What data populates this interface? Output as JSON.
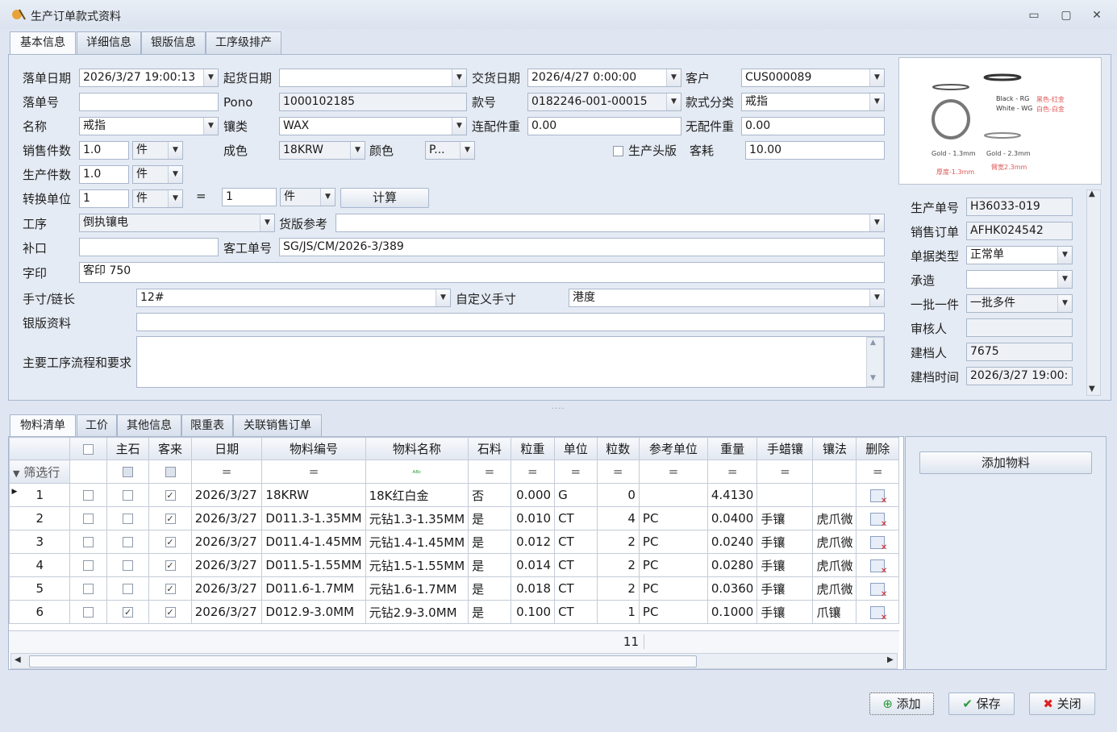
{
  "window": {
    "title": "生产订单款式资料",
    "min": "▭",
    "max": "▢",
    "close": "✕"
  },
  "top_tabs": [
    "基本信息",
    "详细信息",
    "银版信息",
    "工序级排产"
  ],
  "form": {
    "order_date_label": "落单日期",
    "order_date": "2026/3/27 19:00:13",
    "start_date_label": "起货日期",
    "start_date": "",
    "delivery_date_label": "交货日期",
    "delivery_date": "2026/4/27 0:00:00",
    "customer_label": "客户",
    "customer": "CUS000089",
    "order_no_label": "落单号",
    "order_no": "",
    "pono_label": "Pono",
    "pono": "1000102185",
    "style_no_label": "款号",
    "style_no": "0182246-001-00015",
    "style_cat_label": "款式分类",
    "style_cat": "戒指",
    "name_label": "名称",
    "name": "戒指",
    "setting_label": "镶类",
    "setting": "WAX",
    "parts_wt_label": "连配件重",
    "parts_wt": "0.00",
    "no_parts_wt_label": "无配件重",
    "no_parts_wt": "0.00",
    "sales_qty_label": "销售件数",
    "sales_qty": "1.0",
    "sales_unit": "件",
    "color_label": "成色",
    "color": "18KRW",
    "hue_label": "颜色",
    "hue": "P...",
    "prod_head_label": "生产头版",
    "loss_label": "客耗",
    "loss": "10.00",
    "prod_qty_label": "生产件数",
    "prod_qty": "1.0",
    "prod_unit": "件",
    "conv_label": "转换单位",
    "conv_qty": "1",
    "conv_unit": "件",
    "eq": "=",
    "conv_qty2": "1",
    "conv_unit2": "件",
    "calc_button": "计算",
    "process_label": "工序",
    "process": "倒执镶电",
    "goods_ref_label": "货版参考",
    "goods_ref": "",
    "supplement_label": "补口",
    "supplement": "",
    "cust_order_label": "客工单号",
    "cust_order": "SG/JS/CM/2026-3/389",
    "engrave_label": "字印",
    "engrave": "客印 750",
    "size_label": "手寸/链长",
    "size": "12#",
    "custom_size_label": "自定义手寸",
    "custom_size": "港度",
    "silver_label": "银版资料",
    "silver": "",
    "flow_label": "主要工序流程和要求",
    "flow": ""
  },
  "image": {
    "black_rg": "Black - RG",
    "white_wg": "White - WG",
    "red_gold": "黑色-红金",
    "white_gold": "白色-白金",
    "gold_13": "Gold - 1.3mm",
    "gold_23": "Gold - 2.3mm",
    "thick": "厚度-1.3mm",
    "arm": "臂宽2.3mm"
  },
  "side": {
    "prod_no_label": "生产单号",
    "prod_no": "H36033-019",
    "sales_order_label": "销售订单",
    "sales_order": "AFHK024542",
    "doc_type_label": "单据类型",
    "doc_type": "正常单",
    "maker_label": "承造",
    "maker": "",
    "batch_label": "一批一件",
    "batch": "一批多件",
    "reviewer_label": "审核人",
    "reviewer": "",
    "creator_label": "建档人",
    "creator": "7675",
    "created_label": "建档时间",
    "created": "2026/3/27 19:00:"
  },
  "bottom_tabs": [
    "物料清单",
    "工价",
    "其他信息",
    "限重表",
    "关联销售订单"
  ],
  "grid": {
    "headers": [
      "",
      "主石",
      "客来",
      "日期",
      "物料编号",
      "物料名称",
      "石料",
      "粒重",
      "单位",
      "粒数",
      "参考单位",
      "重量",
      "手蜡镶",
      "镶法",
      "删除"
    ],
    "filter_label": "筛选行",
    "rows": [
      {
        "n": "1",
        "c0": false,
        "main": false,
        "client": true,
        "date": "2026/3/27",
        "code": "18KRW",
        "mname": "18K红白金",
        "stone": "否",
        "pw": "0.000",
        "unit": "G",
        "cnt": "0",
        "ref": "",
        "wt": "4.4130",
        "wax": "",
        "method": ""
      },
      {
        "n": "2",
        "c0": false,
        "main": false,
        "client": true,
        "date": "2026/3/27",
        "code": "D011.3-1.35MM",
        "mname": "元钻1.3-1.35MM",
        "stone": "是",
        "pw": "0.010",
        "unit": "CT",
        "cnt": "4",
        "ref": "PC",
        "wt": "0.0400",
        "wax": "手镶",
        "method": "虎爪微"
      },
      {
        "n": "3",
        "c0": false,
        "main": false,
        "client": true,
        "date": "2026/3/27",
        "code": "D011.4-1.45MM",
        "mname": "元钻1.4-1.45MM",
        "stone": "是",
        "pw": "0.012",
        "unit": "CT",
        "cnt": "2",
        "ref": "PC",
        "wt": "0.0240",
        "wax": "手镶",
        "method": "虎爪微"
      },
      {
        "n": "4",
        "c0": false,
        "main": false,
        "client": true,
        "date": "2026/3/27",
        "code": "D011.5-1.55MM",
        "mname": "元钻1.5-1.55MM",
        "stone": "是",
        "pw": "0.014",
        "unit": "CT",
        "cnt": "2",
        "ref": "PC",
        "wt": "0.0280",
        "wax": "手镶",
        "method": "虎爪微"
      },
      {
        "n": "5",
        "c0": false,
        "main": false,
        "client": true,
        "date": "2026/3/27",
        "code": "D011.6-1.7MM",
        "mname": "元钻1.6-1.7MM",
        "stone": "是",
        "pw": "0.018",
        "unit": "CT",
        "cnt": "2",
        "ref": "PC",
        "wt": "0.0360",
        "wax": "手镶",
        "method": "虎爪微"
      },
      {
        "n": "6",
        "c0": false,
        "main": true,
        "client": true,
        "date": "2026/3/27",
        "code": "D012.9-3.0MM",
        "mname": "元钻2.9-3.0MM",
        "stone": "是",
        "pw": "0.100",
        "unit": "CT",
        "cnt": "1",
        "ref": "PC",
        "wt": "0.1000",
        "wax": "手镶",
        "method": "爪镶"
      }
    ],
    "footer_count": "11"
  },
  "add_material_button": "添加物料",
  "footer": {
    "add": "添加",
    "save": "保存",
    "close": "关闭"
  },
  "colors": {
    "accent": "#a6b6cf",
    "bg": "#dfe6f1"
  }
}
